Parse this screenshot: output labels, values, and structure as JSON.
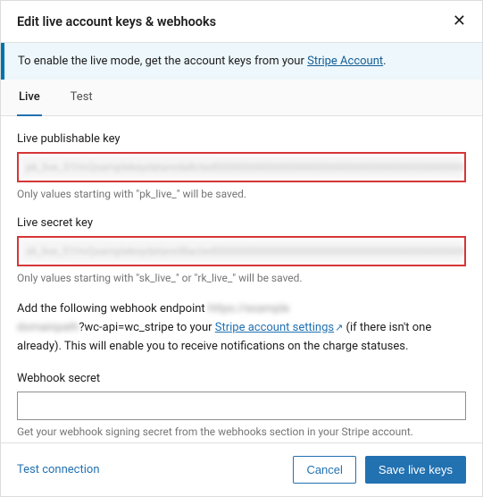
{
  "header": {
    "title": "Edit live account keys & webhooks"
  },
  "notice": {
    "prefix": "To enable the live mode, get the account keys from your ",
    "link": "Stripe Account",
    "suffix": "."
  },
  "tabs": {
    "live": "Live",
    "test": "Test",
    "active": "live"
  },
  "fields": {
    "pub": {
      "label": "Live publishable key",
      "masked_value": "pk_live_51HvQxamplekeydatareda8cted00000000000000000000000000000000000000000000",
      "help": "Only values starting with \"pk_live_\" will be saved."
    },
    "secret": {
      "label": "Live secret key",
      "masked_value": "sk_live_51HvQxamplekeydatared8acted0000000000000000000000000000000000000000000C",
      "help": "Only values starting with \"sk_live_\" or \"rk_live_\" will be saved."
    },
    "webhook": {
      "intro_prefix": "Add the following webhook endpoint ",
      "masked_url_1": "https://example",
      "masked_url_2": "domainpath",
      "visible_query": "?wc-api=wc_stripe",
      "mid": " to your ",
      "link": "Stripe account settings",
      "after_link": " (if there isn't one already). This will enable you to receive notifications on the charge statuses."
    },
    "whsecret": {
      "label": "Webhook secret",
      "value": "",
      "help": "Get your webhook signing secret from the webhooks section in your Stripe account."
    }
  },
  "footer": {
    "test_connection": "Test connection",
    "cancel": "Cancel",
    "save": "Save live keys"
  }
}
